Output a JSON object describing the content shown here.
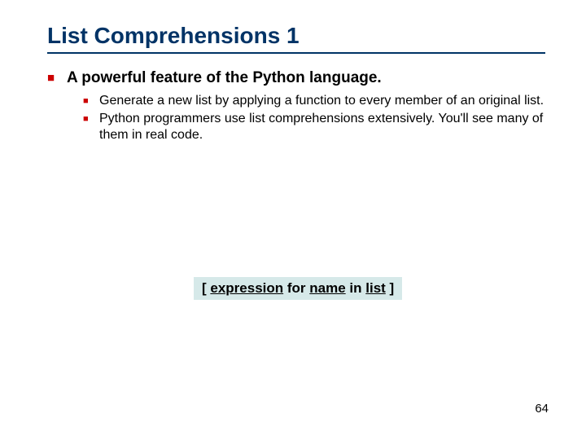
{
  "title": "List Comprehensions 1",
  "heading": "A powerful feature of the Python language.",
  "points": [
    "Generate a new list by applying a function to every member of an original list.",
    "Python programmers use list comprehensions extensively. You'll see many of them in real code."
  ],
  "syntax": {
    "open": "[ ",
    "expression": "expression",
    "for": " for ",
    "name": "name",
    "in": " in ",
    "list": "list",
    "close": " ]"
  },
  "page_number": "64"
}
